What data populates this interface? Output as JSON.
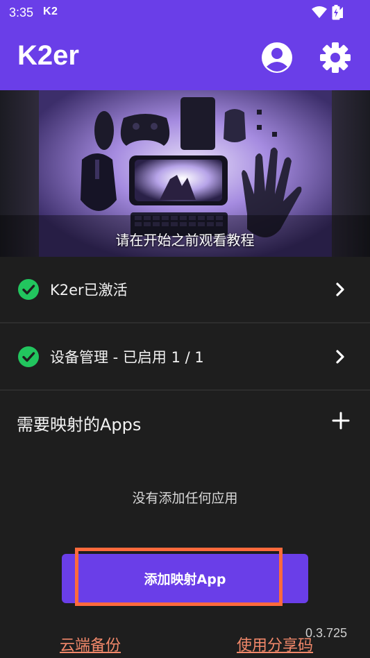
{
  "status_bar": {
    "time": "3:35",
    "app_indicator": "K2",
    "icons": [
      "wifi-icon",
      "cell-signal-icon",
      "battery-icon"
    ]
  },
  "app_bar": {
    "title": "K2er",
    "actions": [
      "account-icon",
      "settings-gear-icon"
    ]
  },
  "banner": {
    "caption": "请在开始之前观看教程"
  },
  "rows": [
    {
      "label": "K2er已激活",
      "icon": "check-circle-icon"
    },
    {
      "label": "设备管理 - 已启用 1 / 1",
      "icon": "check-circle-icon"
    }
  ],
  "apps_section": {
    "title": "需要映射的Apps",
    "empty_text": "没有添加任何应用",
    "add_button_label": "添加映射App"
  },
  "footer": {
    "version": "0.3.725",
    "backup_link": "云端备份",
    "share_link": "使用分享码"
  },
  "colors": {
    "accent": "#6a3ee8",
    "background": "#1e1e1e",
    "success": "#22c55e",
    "link": "#f2886a",
    "highlight": "#ff6a3c"
  }
}
